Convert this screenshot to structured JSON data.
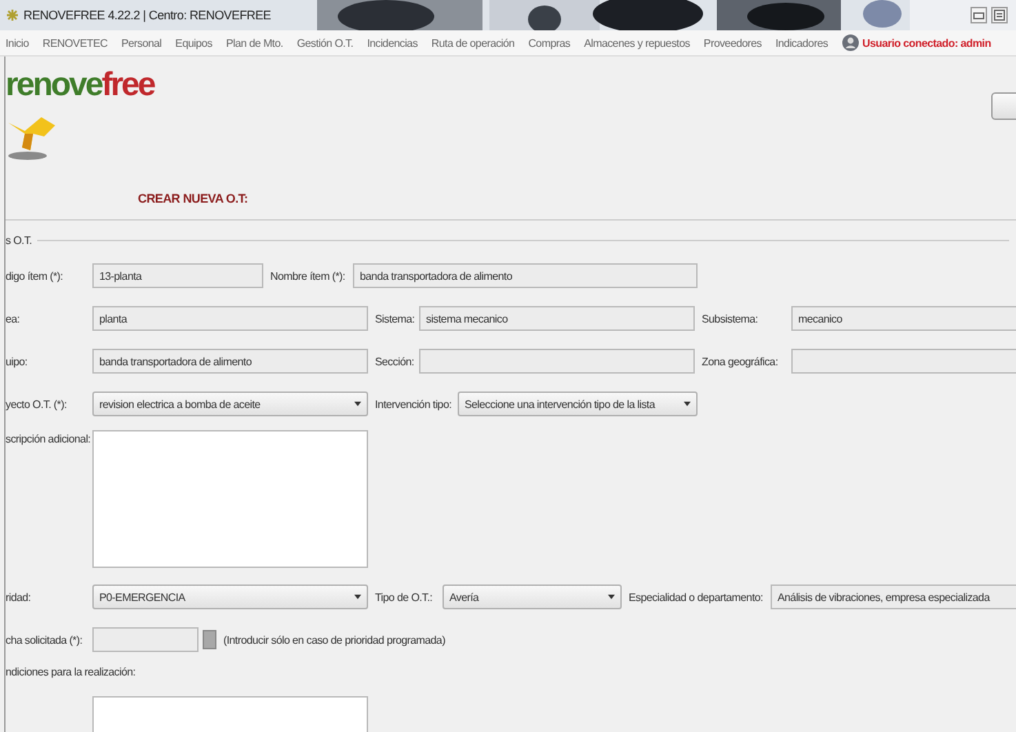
{
  "window": {
    "title": "RENOVEFREE 4.22.2 | Centro: RENOVEFREE"
  },
  "menu": [
    "Inicio",
    "RENOVETEC",
    "Personal",
    "Equipos",
    "Plan de Mto.",
    "Gestión O.T.",
    "Incidencias",
    "Ruta de operación",
    "Compras",
    "Almacenes y repuestos",
    "Proveedores",
    "Indicadores"
  ],
  "user": "Usuario conectado: admin",
  "logo": [
    "renove",
    "free"
  ],
  "heading": "CREAR NUEVA O.T:",
  "group_label": "s O.T.",
  "fields": {
    "codigo_item": {
      "label": "digo ítem (*):",
      "value": "13-planta",
      "disabled": true
    },
    "nombre_item": {
      "label": "Nombre ítem (*):",
      "value": "banda transportadora de alimento",
      "disabled": true
    },
    "area": {
      "label": "ea:",
      "value": "planta",
      "disabled": true
    },
    "sistema": {
      "label": "Sistema:",
      "value": "sistema mecanico",
      "disabled": true
    },
    "subsistema": {
      "label": "Subsistema:",
      "value": "mecanico",
      "disabled": true
    },
    "equipo": {
      "label": "uipo:",
      "value": "banda transportadora de alimento",
      "disabled": true
    },
    "seccion": {
      "label": "Sección:",
      "disabled": true
    },
    "zona": {
      "label": "Zona geográfica:",
      "disabled": true
    },
    "proyecto": {
      "label": "yecto O.T. (*):",
      "value": "revision electrica a bomba de aceite"
    },
    "intervencion": {
      "label": "Intervención tipo:",
      "value": "Seleccione una intervención tipo de la lista"
    },
    "descripcion": {
      "label": "scripción adicional:",
      "disabled": false
    },
    "prioridad": {
      "label": "ridad:",
      "value": "P0-EMERGENCIA"
    },
    "tipo": {
      "label": "Tipo de O.T.:",
      "value": "Avería"
    },
    "especialidad": {
      "label": "Especialidad o departamento:",
      "value": "Análisis de vibraciones, empresa especializada",
      "disabled": true
    },
    "fecha": {
      "label": "cha solicitada (*):",
      "disabled": true,
      "note": "(Introducir sólo en caso de prioridad programada)"
    },
    "condiciones": {
      "label": "ndiciones para la realización:",
      "disabled": false
    }
  }
}
